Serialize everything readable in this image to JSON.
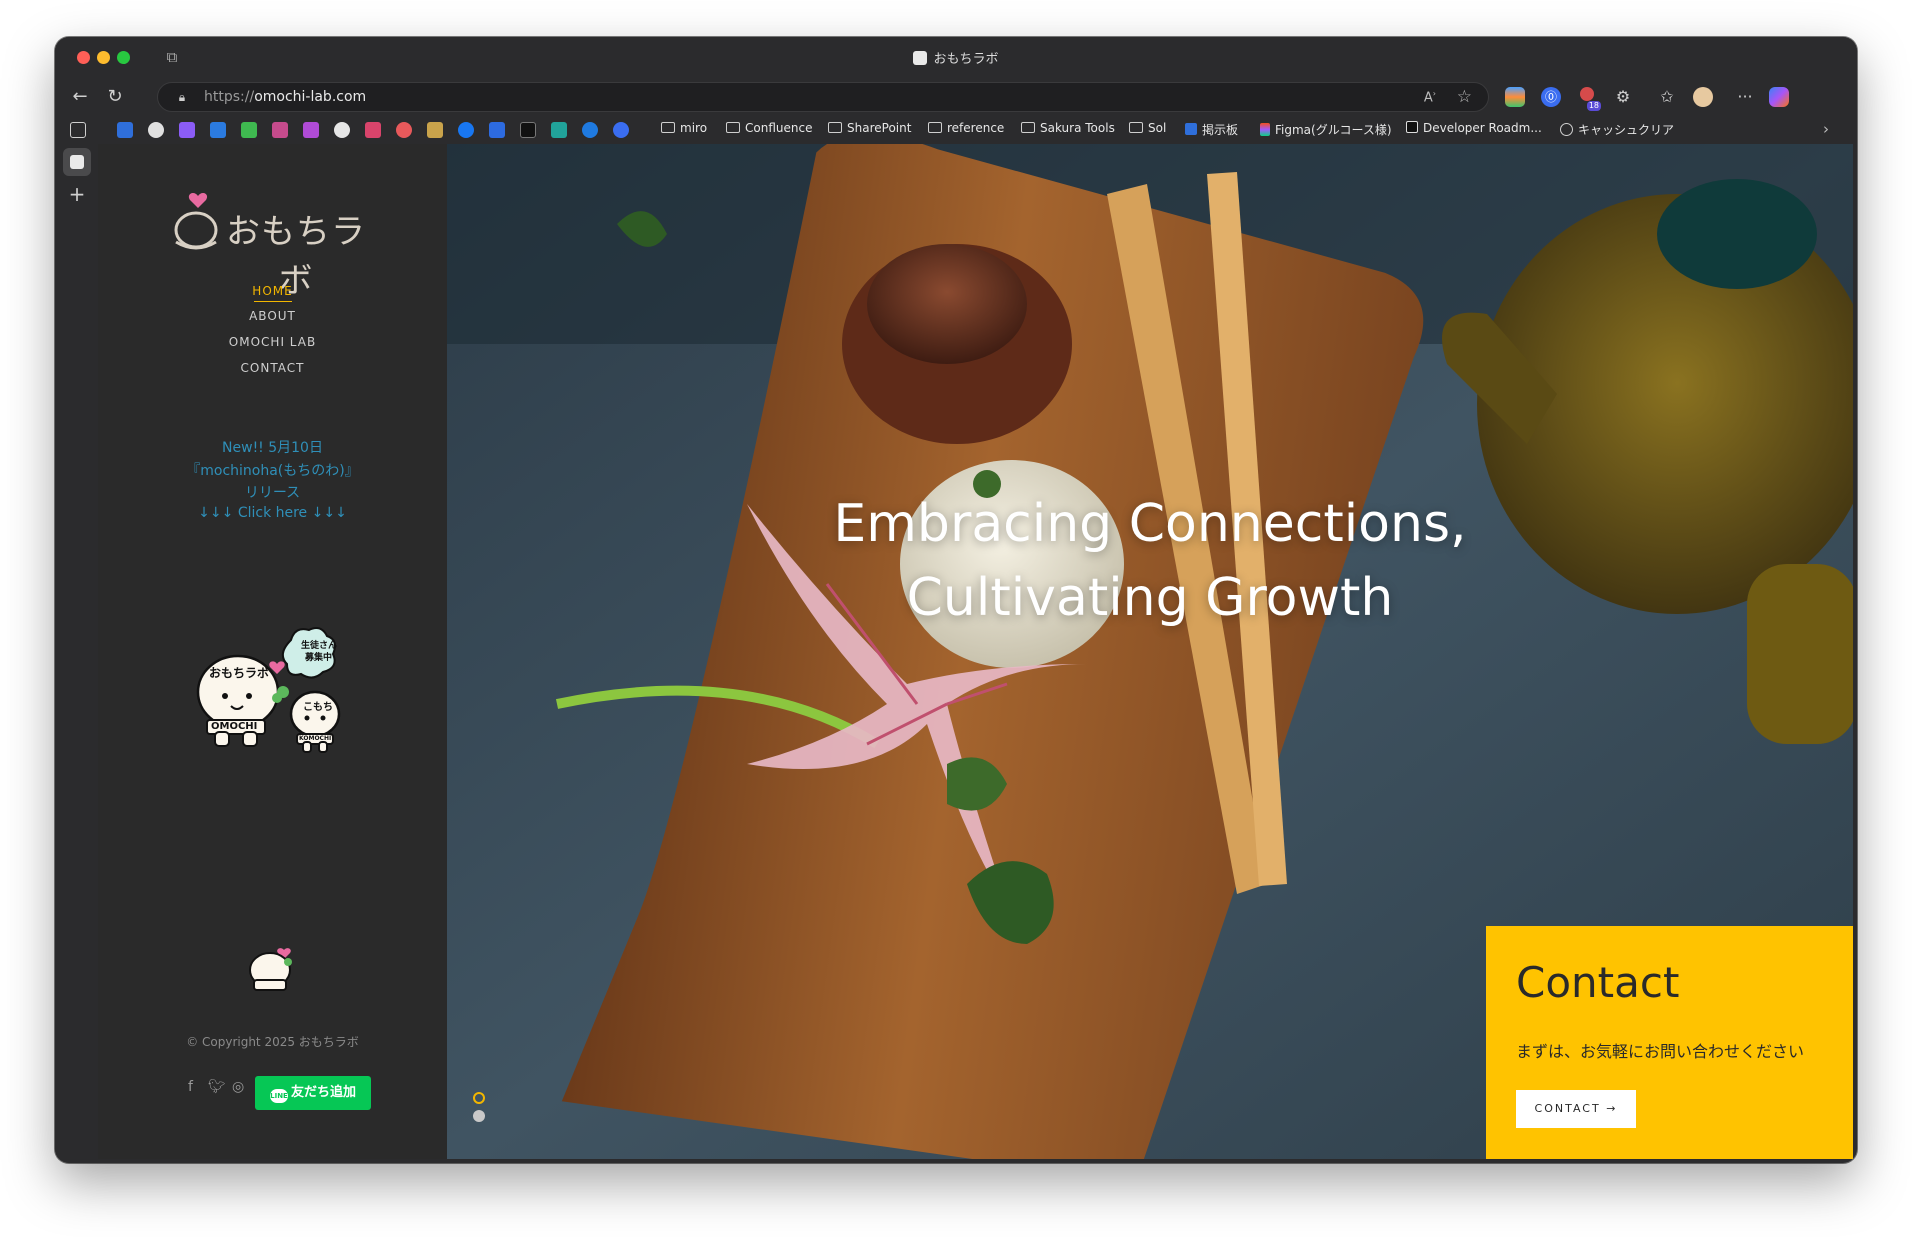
{
  "browser": {
    "window_title": "おもちラボ",
    "url_protocol": "https://",
    "url_host": "omochi-lab.com",
    "reader_label": "A",
    "extension_badge": "18",
    "bookmarks": [
      {
        "label": "miro"
      },
      {
        "label": "Confluence"
      },
      {
        "label": "SharePoint"
      },
      {
        "label": "reference"
      },
      {
        "label": "Sakura Tools"
      },
      {
        "label": "Sol"
      },
      {
        "label": "掲示板"
      },
      {
        "label": "Figma(グルコース様)"
      },
      {
        "label": "Developer Roadm..."
      },
      {
        "label": "キャッシュクリア"
      }
    ]
  },
  "site": {
    "logo_text": "おもちラボ",
    "nav": {
      "home": "HOME",
      "about": "ABOUT",
      "omochi_lab": "OMOCHI LAB",
      "contact": "CONTACT"
    },
    "news": {
      "line1": "New!! 5月10日",
      "line2": "『mochinoha(もちのわ)』",
      "line3": "リリース",
      "line4": "↓↓↓ Click here ↓↓↓"
    },
    "mascot": {
      "bubble1": "生徒さん",
      "bubble2": "募集中",
      "name_big": "おもちラボ",
      "tag_big": "OMOCHI",
      "name_small": "こもち",
      "tag_small": "KOMOCHI"
    },
    "copyright": "© Copyright 2025 おもちラボ",
    "line_button": "友だち追加",
    "line_badge": "LINE"
  },
  "hero": {
    "line1": "Embracing Connections,",
    "line2": "Cultivating Growth"
  },
  "contact_box": {
    "title": "Contact",
    "subtitle": "まずは、お気軽にお問い合わせください",
    "button": "CONTACT →"
  },
  "colors": {
    "accent_yellow": "#ffc300",
    "nav_active": "#f2b600",
    "news_blue": "#2f8fb8",
    "line_green": "#06c755"
  }
}
